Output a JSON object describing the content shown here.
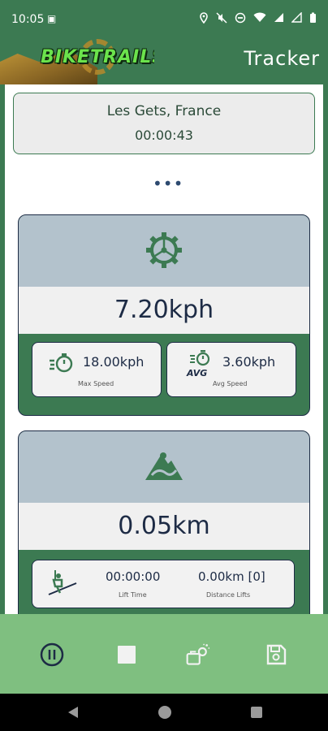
{
  "status_bar": {
    "time": "10:05",
    "icons": [
      "sim-card-icon",
      "location-icon",
      "mute-icon",
      "dnd-icon",
      "wifi-icon",
      "signal-icon",
      "signal-icon",
      "battery-icon"
    ]
  },
  "header": {
    "logo_text": "BIKETRAILS",
    "title": "Tracker"
  },
  "location": {
    "name": "Les Gets, France",
    "elapsed": "00:00:43"
  },
  "more_indicator": "•••",
  "speed_card": {
    "icon": "gear-icon",
    "value": "7.20kph",
    "max": {
      "icon": "stopwatch-icon",
      "value": "18.00kph",
      "label": "Max Speed"
    },
    "avg": {
      "icon": "stopwatch-avg-icon",
      "icon_text": "AVG",
      "value": "3.60kph",
      "label": "Avg Speed"
    }
  },
  "distance_card": {
    "icon": "mountain-bike-icon",
    "value": "0.05km",
    "lift_time": {
      "icon": "ski-lift-icon",
      "value": "00:00:00",
      "label": "Lift Time"
    },
    "lift_distance": {
      "value": "0.00km [0]",
      "label": "Distance Lifts"
    }
  },
  "bottom_bar": {
    "buttons": [
      "pause-icon",
      "stop-icon",
      "add-photo-icon",
      "save-icon"
    ]
  },
  "colors": {
    "primary_green": "#3c7a52",
    "light_green": "#7fbf80",
    "navy": "#1d2b45",
    "card_grey": "#b3c2cc"
  }
}
